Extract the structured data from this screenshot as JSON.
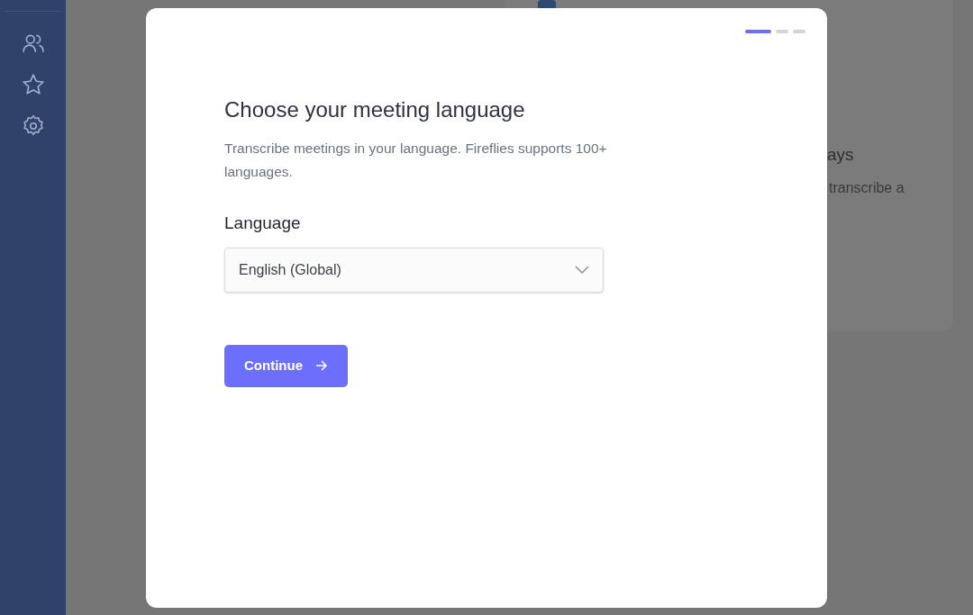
{
  "sidebar": {
    "items": [
      {
        "kind": "people"
      },
      {
        "kind": "star"
      },
      {
        "kind": "settings"
      }
    ]
  },
  "background_card": {
    "heading": "ays",
    "text": "transcribe a"
  },
  "dialog": {
    "steps": [
      {
        "selected": true
      },
      {
        "selected": false
      },
      {
        "selected": false
      }
    ],
    "title": "Choose your meeting language",
    "description": "Transcribe meetings in your language. Fireflies supports 100+ languages.",
    "field_label": "Language",
    "language_select": {
      "value": "English (Global)"
    },
    "continue_button": {
      "label": "Continue"
    }
  }
}
